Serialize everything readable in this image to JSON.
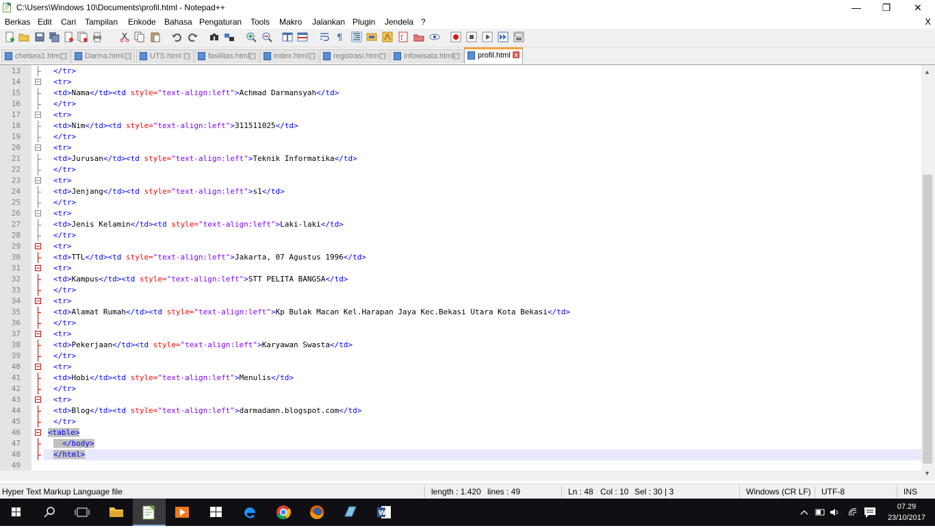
{
  "window": {
    "title": "C:\\Users\\Windows 10\\Documents\\profil.html - Notepad++",
    "minimize": "—",
    "maximize": "❐",
    "close": "✕"
  },
  "menu": {
    "items": [
      "Berkas",
      "Edit",
      "Cari",
      "Tampilan",
      "Enkode",
      "Bahasa",
      "Pengaturan",
      "Tools",
      "Makro",
      "Jalankan",
      "Plugin",
      "Jendela",
      "?"
    ],
    "close_doc": "X"
  },
  "tabs": [
    {
      "label": "chelsea1.html",
      "active": false
    },
    {
      "label": "Darma.html",
      "active": false
    },
    {
      "label": "UTS.html",
      "active": false
    },
    {
      "label": "fasilitas.html",
      "active": false
    },
    {
      "label": "index.html",
      "active": false
    },
    {
      "label": "registrasi.html",
      "active": false
    },
    {
      "label": "infowisata.html",
      "active": false
    },
    {
      "label": "profil.html",
      "active": true
    }
  ],
  "tab_close_glyph": "x",
  "editor": {
    "lines": [
      {
        "n": "13",
        "text": "</tr>"
      },
      {
        "n": "14",
        "text": "<tr>"
      },
      {
        "n": "15",
        "text": "<td>Nama</td><td style=\"text-align:left\">Achmad Darmansyah</td>"
      },
      {
        "n": "16",
        "text": "</tr>"
      },
      {
        "n": "17",
        "text": "<tr>"
      },
      {
        "n": "18",
        "text": "<td>Nim</td><td style=\"text-align:left\">311511025</td>"
      },
      {
        "n": "19",
        "text": "</tr>"
      },
      {
        "n": "20",
        "text": "<tr>"
      },
      {
        "n": "21",
        "text": "<td>Jurusan</td><td style=\"text-align:left\">Teknik Informatika</td>"
      },
      {
        "n": "22",
        "text": "</tr>"
      },
      {
        "n": "23",
        "text": "<tr>"
      },
      {
        "n": "24",
        "text": "<td>Jenjang</td><td style=\"text-align:left\">s1</td>"
      },
      {
        "n": "25",
        "text": "</tr>"
      },
      {
        "n": "26",
        "text": "<tr>"
      },
      {
        "n": "27",
        "text": "<td>Jenis Kelamin</td><td style=\"text-align:left\">Laki-laki</td>"
      },
      {
        "n": "28",
        "text": "</tr>"
      },
      {
        "n": "29",
        "text": "<tr>"
      },
      {
        "n": "30",
        "text": "<td>TTL</td><td style=\"text-align:left\">Jakarta, 07 Agustus 1996</td>"
      },
      {
        "n": "31",
        "text": "<tr>"
      },
      {
        "n": "32",
        "text": "<td>Kampus</td><td style=\"text-align:left\">STT PELITA BANGSA</td>"
      },
      {
        "n": "33",
        "text": "</tr>"
      },
      {
        "n": "34",
        "text": "<tr>"
      },
      {
        "n": "35",
        "text": "<td>Alamat Rumah</td><td style=\"text-align:left\">Kp Bulak Macan Kel.Harapan Jaya Kec.Bekasi Utara Kota Bekasi</td>"
      },
      {
        "n": "36",
        "text": "</tr>"
      },
      {
        "n": "37",
        "text": "<tr>"
      },
      {
        "n": "38",
        "text": "<td>Pekerjaan</td><td style=\"text-align:left\">Karyawan Swasta</td>"
      },
      {
        "n": "39",
        "text": "</tr>"
      },
      {
        "n": "40",
        "text": "<tr>"
      },
      {
        "n": "41",
        "text": "<td>Hobi</td><td style=\"text-align:left\">Menulis</td>"
      },
      {
        "n": "42",
        "text": "</tr>"
      },
      {
        "n": "43",
        "text": "<tr>"
      },
      {
        "n": "44",
        "text": "<td>Blog</td><td style=\"text-align:left\">darmadamn.blogspot.com</td>"
      },
      {
        "n": "45",
        "text": "</tr>"
      },
      {
        "n": "46",
        "text": "<table>"
      },
      {
        "n": "47",
        "text": "  </body>"
      },
      {
        "n": "48",
        "text": "</html>"
      },
      {
        "n": "49",
        "text": ""
      }
    ]
  },
  "status": {
    "filetype": "Hyper Text Markup Language file",
    "length": "length : 1.420",
    "lines": "lines : 49",
    "ln": "Ln : 48",
    "col": "Col : 10",
    "sel": "Sel : 30 | 3",
    "eol": "Windows (CR LF)",
    "encoding": "UTF-8",
    "mode": "INS"
  },
  "taskbar": {
    "time": "07.29",
    "date": "23/10/2017"
  }
}
